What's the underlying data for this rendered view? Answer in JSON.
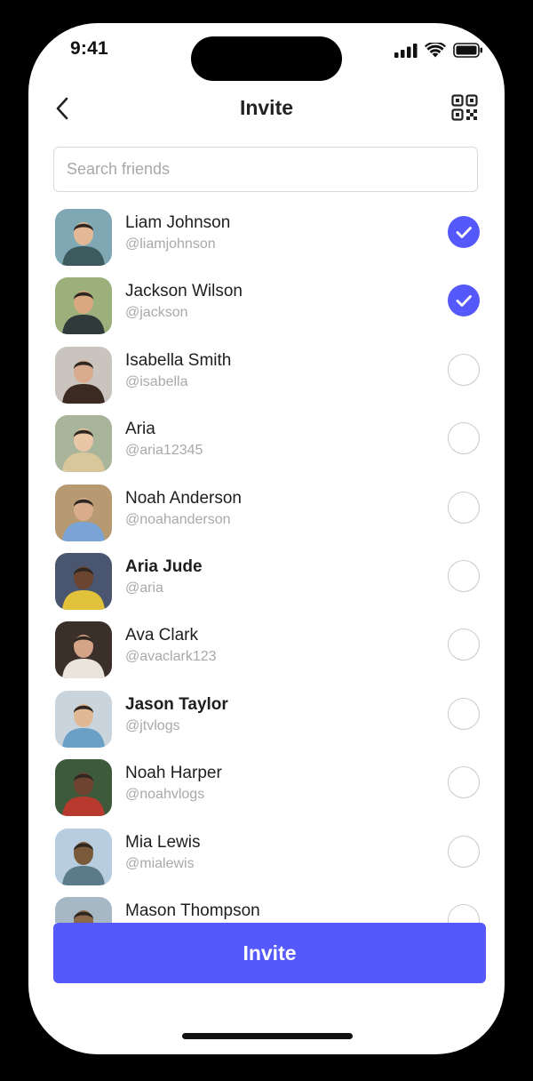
{
  "status_bar": {
    "time": "9:41"
  },
  "header": {
    "title": "Invite",
    "back_icon": "chevron-left-icon",
    "qr_icon": "qr-code-icon"
  },
  "search": {
    "placeholder": "Search friends",
    "value": ""
  },
  "friends": [
    {
      "name": "Liam Johnson",
      "handle": "@liamjohnson",
      "selected": true,
      "bold": false,
      "avatar_colors": [
        "#7fa8b4",
        "#3d5a5e",
        "#e2b896"
      ]
    },
    {
      "name": "Jackson Wilson",
      "handle": "@jackson",
      "selected": true,
      "bold": false,
      "avatar_colors": [
        "#9bb07a",
        "#2f3a3a",
        "#d9a880"
      ]
    },
    {
      "name": "Isabella Smith",
      "handle": "@isabella",
      "selected": false,
      "bold": false,
      "avatar_colors": [
        "#c9c4bd",
        "#3a2a22",
        "#d8ab8e"
      ]
    },
    {
      "name": "Aria",
      "handle": "@aria12345",
      "selected": false,
      "bold": false,
      "avatar_colors": [
        "#a9b59a",
        "#d8c79a",
        "#e9c7a6"
      ]
    },
    {
      "name": "Noah Anderson",
      "handle": "@noahanderson",
      "selected": false,
      "bold": false,
      "avatar_colors": [
        "#b79a72",
        "#7aa4d6",
        "#d9ad8c"
      ]
    },
    {
      "name": "Aria Jude",
      "handle": "@aria",
      "selected": false,
      "bold": true,
      "avatar_colors": [
        "#4a5570",
        "#e2c23a",
        "#6b4530"
      ]
    },
    {
      "name": "Ava Clark",
      "handle": "@avaclark123",
      "selected": false,
      "bold": false,
      "avatar_colors": [
        "#3b2f2a",
        "#e9e4dc",
        "#d5a488"
      ]
    },
    {
      "name": "Jason Taylor",
      "handle": "@jtvlogs",
      "selected": false,
      "bold": true,
      "avatar_colors": [
        "#c9d4dc",
        "#6aa0c6",
        "#e0b894"
      ]
    },
    {
      "name": "Noah Harper",
      "handle": "@noahvlogs",
      "selected": false,
      "bold": false,
      "avatar_colors": [
        "#3d5a3a",
        "#b83a2e",
        "#6e4430"
      ]
    },
    {
      "name": "Mia Lewis",
      "handle": "@mialewis",
      "selected": false,
      "bold": false,
      "avatar_colors": [
        "#b9cde0",
        "#5b7a8a",
        "#7a5a3a"
      ]
    },
    {
      "name": "Mason Thompson",
      "handle": "",
      "selected": false,
      "bold": false,
      "avatar_colors": [
        "#a7b8c5",
        "#d9b394",
        "#8a6a4a"
      ]
    }
  ],
  "accent_color": "#5558fb",
  "invite_button": {
    "label": "Invite"
  }
}
